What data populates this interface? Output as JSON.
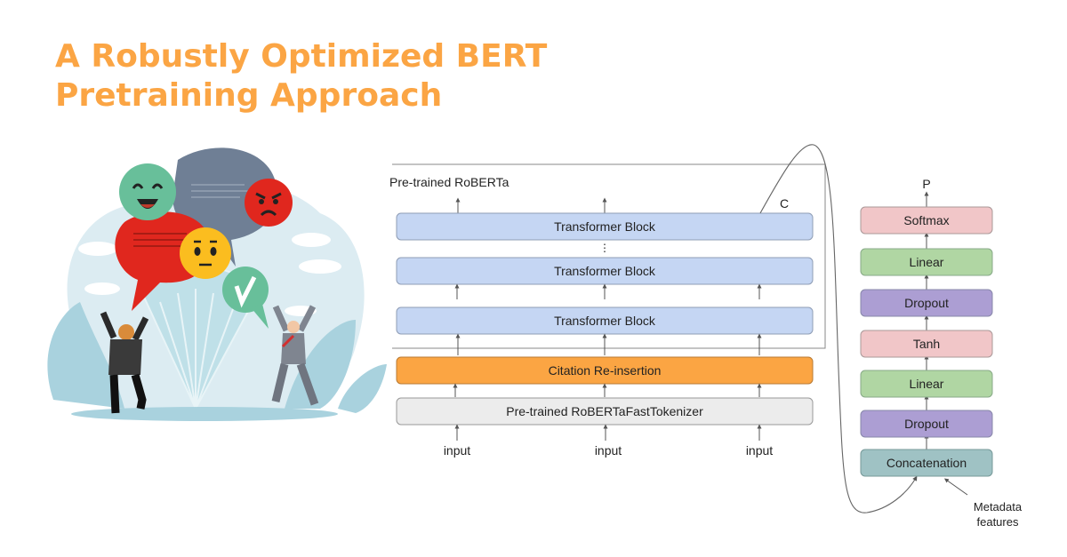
{
  "title": {
    "line1": "A Robustly Optimized BERT",
    "line2": "Pretraining Approach"
  },
  "colors": {
    "title": "#fba544",
    "transformer_block": "#c5d6f3",
    "citation": "#fba543",
    "tokenizer": "#ececec",
    "softmax": "#f1c6c8",
    "linear": "#b0d6a3",
    "dropout": "#ac9ed3",
    "tanh": "#f1c6c8",
    "concatenation": "#9fc2c4"
  },
  "illustration": {
    "description": "feedback emoji speech bubbles with two celebrating business people",
    "icons": [
      "happy-face-icon",
      "angry-face-icon",
      "neutral-face-icon",
      "checkmark-icon",
      "speech-bubble-icon"
    ]
  },
  "encoder": {
    "container_label": "Pre-trained RoBERTa",
    "c_label": "C",
    "blocks": [
      {
        "label": "Transformer Block"
      },
      {
        "label": "Transformer Block"
      },
      {
        "label": "Transformer Block"
      }
    ],
    "ellipsis": "⋮",
    "citation_label": "Citation Re-insertion",
    "tokenizer_label": "Pre-trained RoBERTaFastTokenizer",
    "inputs": [
      "input",
      "input",
      "input"
    ]
  },
  "head": {
    "output_label": "P",
    "layers": [
      {
        "label": "Softmax",
        "kind": "softmax"
      },
      {
        "label": "Linear",
        "kind": "linear"
      },
      {
        "label": "Dropout",
        "kind": "dropout"
      },
      {
        "label": "Tanh",
        "kind": "tanh"
      },
      {
        "label": "Linear",
        "kind": "linear"
      },
      {
        "label": "Dropout",
        "kind": "dropout"
      },
      {
        "label": "Concatenation",
        "kind": "concatenation"
      }
    ],
    "metadata_label_line1": "Metadata",
    "metadata_label_line2": "features"
  }
}
